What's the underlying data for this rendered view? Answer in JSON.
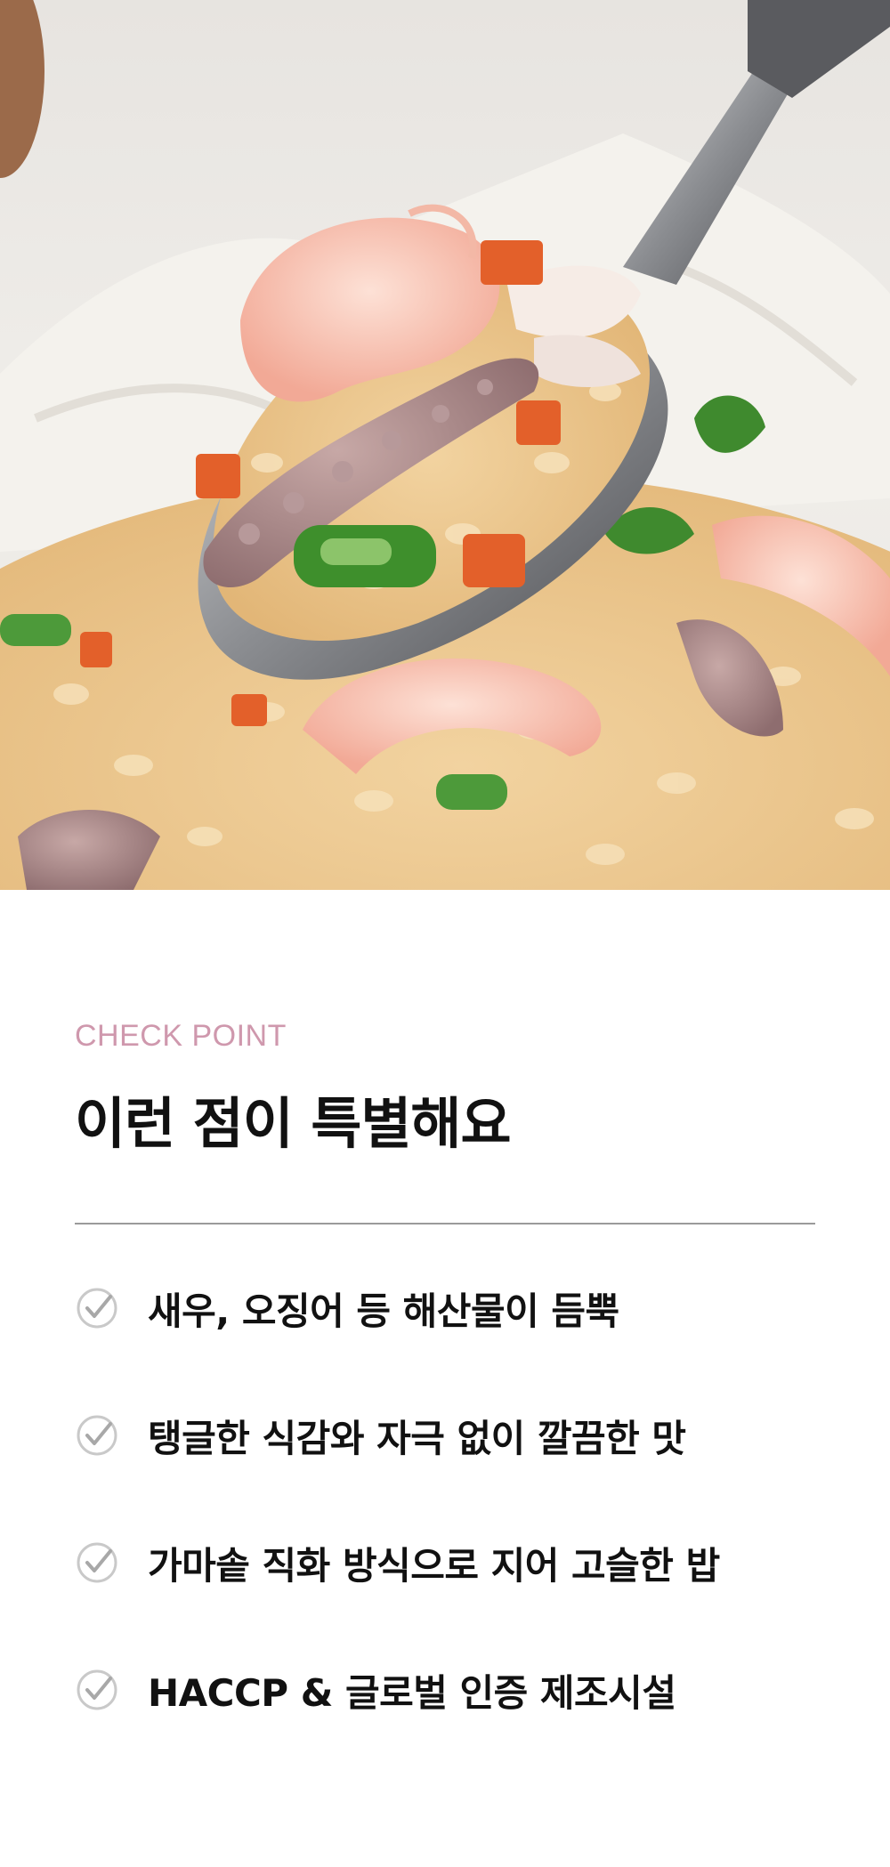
{
  "hero": {
    "alt": "seafood fried rice on a spoon"
  },
  "section": {
    "eyebrow": "CHECK POINT",
    "title": "이런 점이 특별해요"
  },
  "features": [
    {
      "text": "새우, 오징어 등 해산물이 듬뿍",
      "icon": "check-circle-icon"
    },
    {
      "text": "탱글한 식감와 자극 없이 깔끔한 맛",
      "icon": "check-circle-icon"
    },
    {
      "text": "가마솥 직화 방식으로 지어 고슬한 밥",
      "icon": "check-circle-icon"
    },
    {
      "text": "HACCP & 글로벌 인증 제조시설",
      "icon": "check-circle-icon"
    }
  ],
  "colors": {
    "eyebrow": "#cf98ad",
    "title": "#111111",
    "divider": "#9a9a9a",
    "check": "#b8b8b8"
  }
}
